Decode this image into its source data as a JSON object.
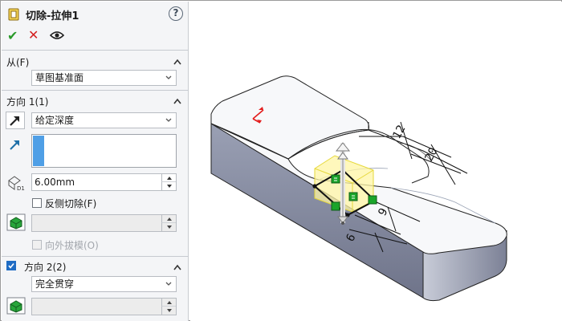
{
  "feature": {
    "title": "切除-拉伸1",
    "help_glyph": "?"
  },
  "toolbar": {
    "ok_glyph": "✔",
    "cancel_glyph": "✕"
  },
  "from": {
    "title": "从(F)",
    "selected": "草图基准面"
  },
  "direction1": {
    "title": "方向 1(1)",
    "end_condition": "给定深度",
    "depth": "6.00mm",
    "flip_side_label": "反侧切除(F)",
    "flip_side_checked": false,
    "draft_outward_label": "向外拔模(O)",
    "draft_outward_enabled": false
  },
  "direction2": {
    "title": "方向 2(2)",
    "enabled": true,
    "end_condition": "完全贯穿"
  },
  "viewport": {
    "dimensions": [
      "12",
      "20",
      "9",
      "6"
    ]
  },
  "colors": {
    "accent": "#1f6cc4",
    "selection": "#4f9fe6",
    "model_face": "#f7f8fa",
    "model_side": "#8b90a3",
    "preview": "#fff8b8",
    "handle": "#1aa52a",
    "direction_arrow": "#e31c1c"
  }
}
